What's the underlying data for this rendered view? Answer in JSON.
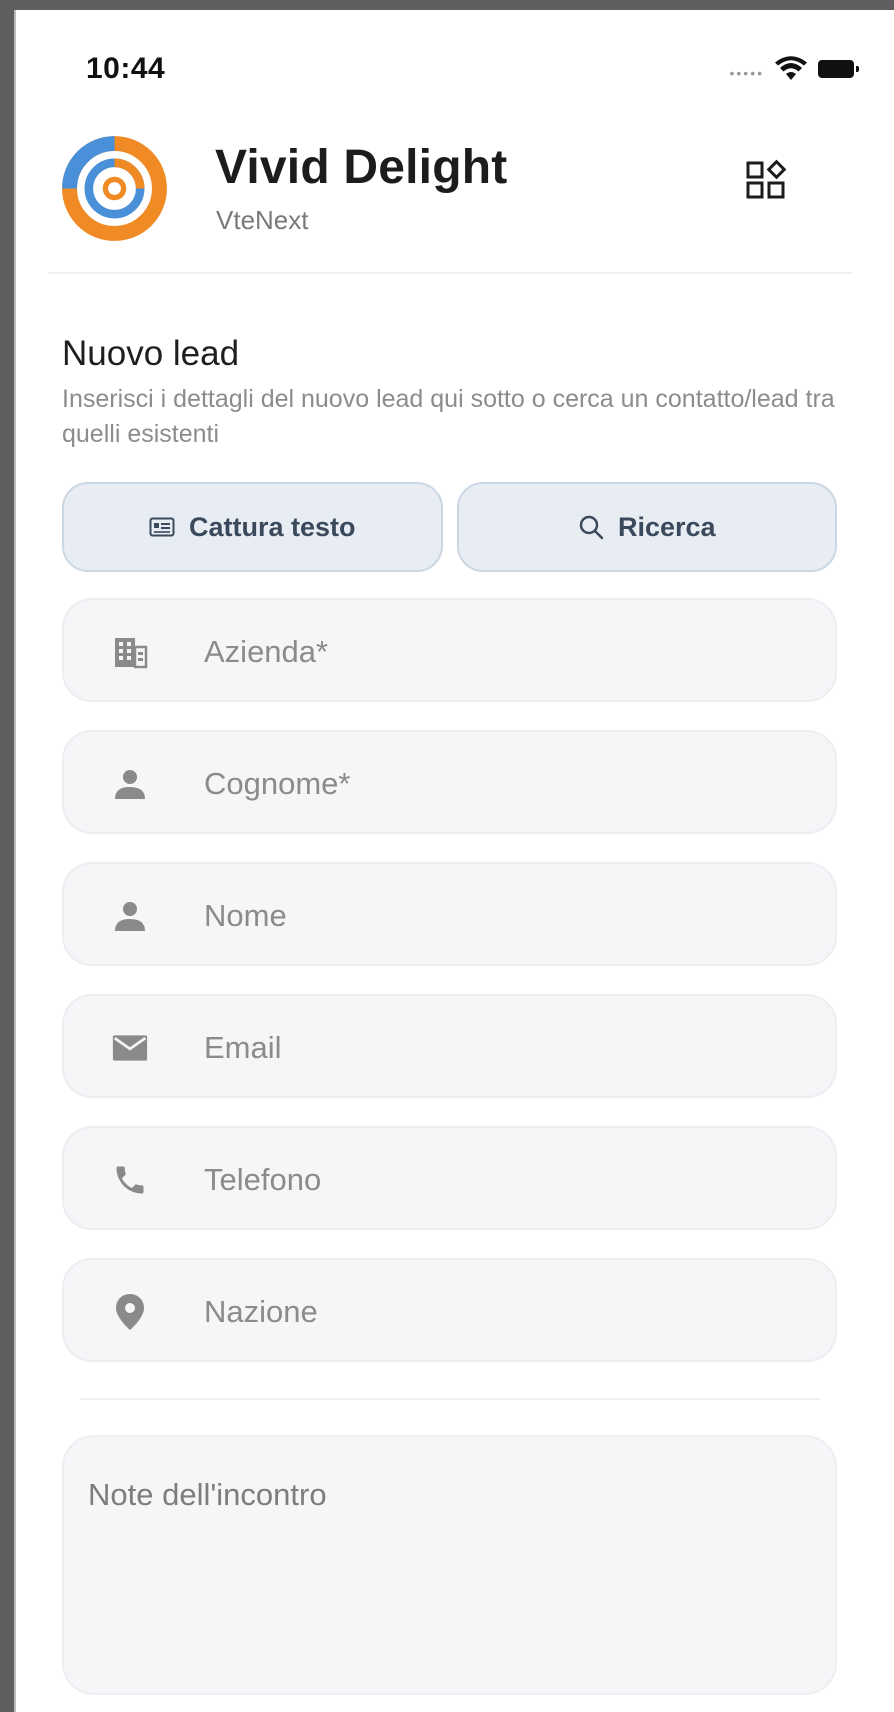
{
  "status_bar": {
    "time": "10:44",
    "signal_icon": "signal-dots-icon",
    "wifi_icon": "wifi-icon",
    "battery_icon": "battery-icon"
  },
  "header": {
    "app_name": "Vivid Delight",
    "app_subtitle": "VteNext",
    "logo_icon": "target-ring-logo",
    "apps_icon": "apps-grid-icon"
  },
  "section": {
    "title": "Nuovo lead",
    "description": "Inserisci i dettagli del nuovo lead qui sotto o cerca un contatto/lead tra quelli esistenti"
  },
  "actions": {
    "capture_label": "Cattura testo",
    "capture_icon": "text-scan-icon",
    "search_label": "Ricerca",
    "search_icon": "search-icon"
  },
  "fields": [
    {
      "placeholder": "Azienda*",
      "icon": "building-icon"
    },
    {
      "placeholder": "Cognome*",
      "icon": "person-icon"
    },
    {
      "placeholder": "Nome",
      "icon": "person-icon"
    },
    {
      "placeholder": "Email",
      "icon": "mail-icon"
    },
    {
      "placeholder": "Telefono",
      "icon": "phone-icon"
    },
    {
      "placeholder": "Nazione",
      "icon": "location-pin-icon"
    }
  ],
  "notes": {
    "placeholder": "Note dell'incontro"
  },
  "colors": {
    "logo_blue": "#4a90d9",
    "logo_orange": "#f08a24",
    "action_bg": "#e8edf3",
    "action_text": "#3a4a5c",
    "field_bg": "#f5f6f8",
    "icon_grey": "#8a8a8a"
  }
}
